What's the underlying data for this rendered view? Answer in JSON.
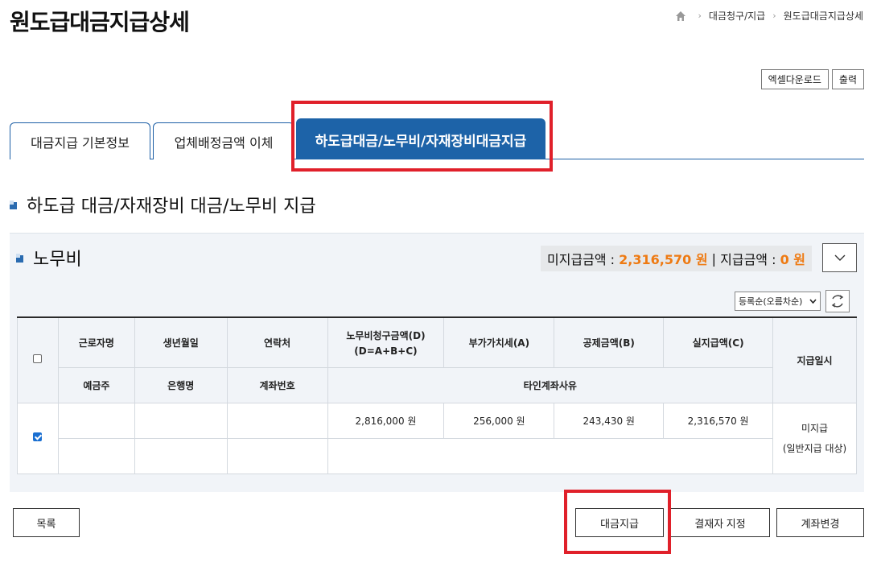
{
  "header": {
    "title": "원도급대금지급상세",
    "breadcrumb": [
      "대금청구/지급",
      "원도급대금지급상세"
    ]
  },
  "toolbar": {
    "excel_label": "엑셀다운로드",
    "print_label": "출력"
  },
  "tabs": [
    {
      "label": "대금지급 기본정보",
      "active": false
    },
    {
      "label": "업체배정금액 이체",
      "active": false
    },
    {
      "label": "하도급대금/노무비/자재장비대금지급",
      "active": true
    }
  ],
  "section": {
    "title": "하도급 대금/자재장비 대금/노무비 지급"
  },
  "panel": {
    "title": "노무비",
    "unpaid_label": "미지급금액 : ",
    "unpaid_value": "2,316,570 원",
    "divider": " | ",
    "paid_label": "지급금액 : ",
    "paid_value": "0 원",
    "sort_value": "등록순(오름차순)"
  },
  "table": {
    "headers_row1": [
      "근로자명",
      "생년월일",
      "연락처",
      "노무비청구금액(D)",
      "부가가치세(A)",
      "공제금액(B)",
      "실지급액(C)",
      "지급일시"
    ],
    "header_formula": "(D=A+B+C)",
    "headers_row2": [
      "예금주",
      "은행명",
      "계좌번호",
      "타인계좌사유"
    ],
    "rows": [
      {
        "checked": true,
        "claim": "2,816,000 원",
        "vat": "256,000 원",
        "deduction": "243,430 원",
        "actual": "2,316,570 원",
        "status_line1": "미지급",
        "status_line2": "(일반지급 대상)"
      }
    ]
  },
  "buttons": {
    "list": "목록",
    "pay": "대금지급",
    "approver": "결재자 지정",
    "account_change": "계좌변경"
  },
  "colors": {
    "primary": "#1d63a8",
    "accent_orange": "#ee7a12",
    "highlight_red": "#e0202a"
  }
}
